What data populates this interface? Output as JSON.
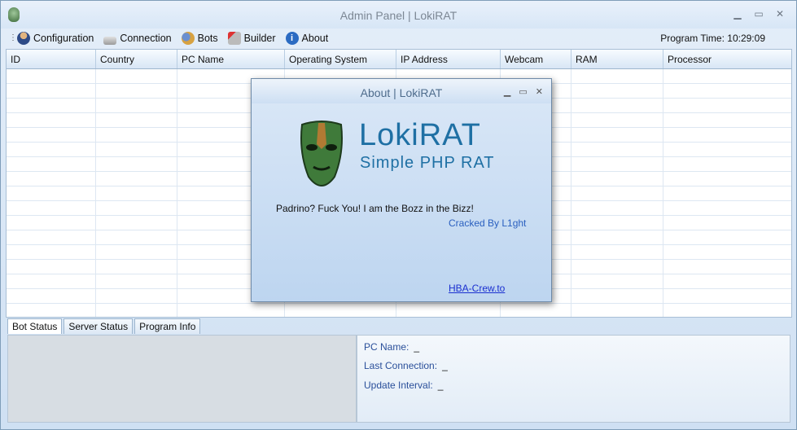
{
  "window": {
    "title": "Admin Panel | LokiRAT",
    "minimize_glyph": "▁",
    "maximize_glyph": "▭",
    "close_glyph": "✕"
  },
  "menu": {
    "items": [
      {
        "label": "Configuration",
        "icon": "user-icon"
      },
      {
        "label": "Connection",
        "icon": "connection-icon"
      },
      {
        "label": "Bots",
        "icon": "bots-icon"
      },
      {
        "label": "Builder",
        "icon": "builder-icon"
      },
      {
        "label": "About",
        "icon": "info-icon"
      }
    ],
    "program_time_label": "Program Time:",
    "program_time_value": "10:29:09"
  },
  "grid": {
    "columns": [
      "ID",
      "Country",
      "PC Name",
      "Operating System",
      "IP Address",
      "Webcam",
      "RAM",
      "Processor"
    ]
  },
  "tabs": [
    "Bot Status",
    "Server Status",
    "Program Info"
  ],
  "status": {
    "pc_name_label": "PC Name:",
    "pc_name_value": "_",
    "last_connection_label": "Last Connection:",
    "last_connection_value": "_",
    "update_interval_label": "Update Interval:",
    "update_interval_value": "_"
  },
  "about": {
    "title": "About | LokiRAT",
    "logo_title": "LokiRAT",
    "logo_subtitle": "Simple PHP RAT",
    "quote": "Padrino? Fuck You! I am the Bozz in the Bizz!",
    "cracked_by": "Cracked By L1ght",
    "link": "HBA-Crew.to"
  },
  "colors": {
    "accent": "#1f70a4",
    "link": "#1a2fd0",
    "label_blue": "#2a4f9a"
  }
}
